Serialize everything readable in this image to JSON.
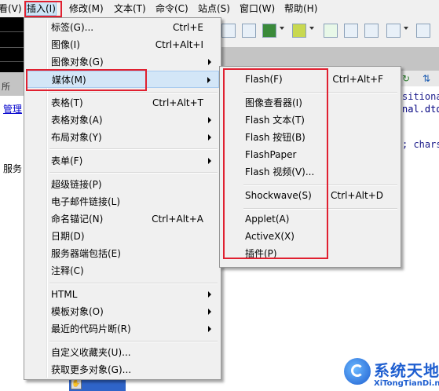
{
  "menubar": {
    "items": [
      "看(V)",
      "插入(I)",
      "修改(M)",
      "文本(T)",
      "命令(C)",
      "站点(S)",
      "窗口(W)",
      "帮助(H)"
    ]
  },
  "background": {
    "left_strip_text": "所",
    "left_link": "管理",
    "left_label": "服务",
    "code_lines": [
      "sitional",
      "nal.dtd\"",
      "; chars"
    ]
  },
  "insert_menu": {
    "items": [
      {
        "label": "标签(G)...",
        "shortcut": "Ctrl+E",
        "submenu": false
      },
      {
        "label": "图像(I)",
        "shortcut": "Ctrl+Alt+I",
        "submenu": false
      },
      {
        "label": "图像对象(G)",
        "shortcut": "",
        "submenu": true
      },
      {
        "label": "媒体(M)",
        "shortcut": "",
        "submenu": true
      },
      {
        "label": "表格(T)",
        "shortcut": "Ctrl+Alt+T",
        "submenu": false
      },
      {
        "label": "表格对象(A)",
        "shortcut": "",
        "submenu": true
      },
      {
        "label": "布局对象(Y)",
        "shortcut": "",
        "submenu": true
      },
      {
        "label": "表单(F)",
        "shortcut": "",
        "submenu": true
      },
      {
        "label": "超级链接(P)",
        "shortcut": "",
        "submenu": false
      },
      {
        "label": "电子邮件链接(L)",
        "shortcut": "",
        "submenu": false
      },
      {
        "label": "命名锚记(N)",
        "shortcut": "Ctrl+Alt+A",
        "submenu": false
      },
      {
        "label": "日期(D)",
        "shortcut": "",
        "submenu": false
      },
      {
        "label": "服务器端包括(E)",
        "shortcut": "",
        "submenu": false
      },
      {
        "label": "注释(C)",
        "shortcut": "",
        "submenu": false
      },
      {
        "label": "HTML",
        "shortcut": "",
        "submenu": true
      },
      {
        "label": "模板对象(O)",
        "shortcut": "",
        "submenu": true
      },
      {
        "label": "最近的代码片断(R)",
        "shortcut": "",
        "submenu": true
      },
      {
        "label": "自定义收藏夹(U)...",
        "shortcut": "",
        "submenu": false
      },
      {
        "label": "获取更多对象(G)...",
        "shortcut": "",
        "submenu": false
      }
    ]
  },
  "media_submenu": {
    "items": [
      {
        "label": "Flash(F)",
        "shortcut": "Ctrl+Alt+F"
      },
      {
        "label": "图像查看器(I)",
        "shortcut": ""
      },
      {
        "label": "Flash 文本(T)",
        "shortcut": ""
      },
      {
        "label": "Flash 按钮(B)",
        "shortcut": ""
      },
      {
        "label": "FlashPaper",
        "shortcut": ""
      },
      {
        "label": "Flash 视频(V)...",
        "shortcut": ""
      },
      {
        "label": "Shockwave(S)",
        "shortcut": "Ctrl+Alt+D"
      },
      {
        "label": "Applet(A)",
        "shortcut": ""
      },
      {
        "label": "ActiveX(X)",
        "shortcut": ""
      },
      {
        "label": "插件(P)",
        "shortcut": ""
      }
    ]
  },
  "watermark": {
    "title": "系统天地",
    "url": "XiTongTianDi.net"
  },
  "colors": {
    "highlight_box": "#e02030",
    "menu_bg": "#f0f0f0",
    "hover_bg": "#d3e6f7"
  }
}
